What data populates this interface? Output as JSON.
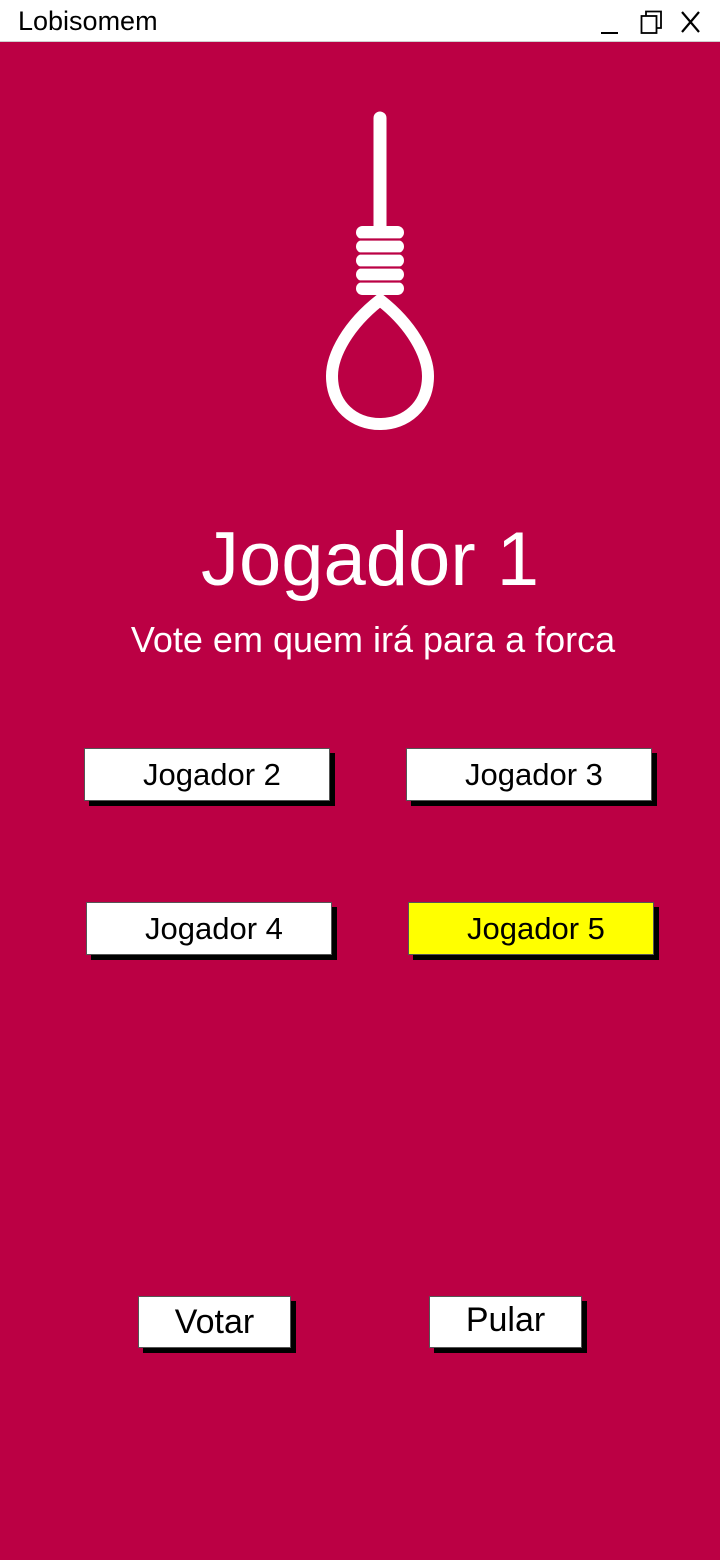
{
  "window": {
    "title": "Lobisomem",
    "controls": {
      "minimize": "_",
      "maximize": "restore-icon",
      "close": "X"
    }
  },
  "colors": {
    "background": "#bb0044",
    "button": "#ffffff",
    "selected": "#ffff00",
    "text_light": "#ffffff"
  },
  "icons": {
    "hero": "noose-icon"
  },
  "screen": {
    "current_player": "Jogador 1",
    "instruction": "Vote em quem irá para a forca"
  },
  "players": [
    {
      "label": "Jogador 2",
      "selected": false
    },
    {
      "label": "Jogador 3",
      "selected": false
    },
    {
      "label": "Jogador 4",
      "selected": false
    },
    {
      "label": "Jogador 5",
      "selected": true
    }
  ],
  "actions": {
    "vote_label": "Votar",
    "skip_label": "Pular"
  }
}
